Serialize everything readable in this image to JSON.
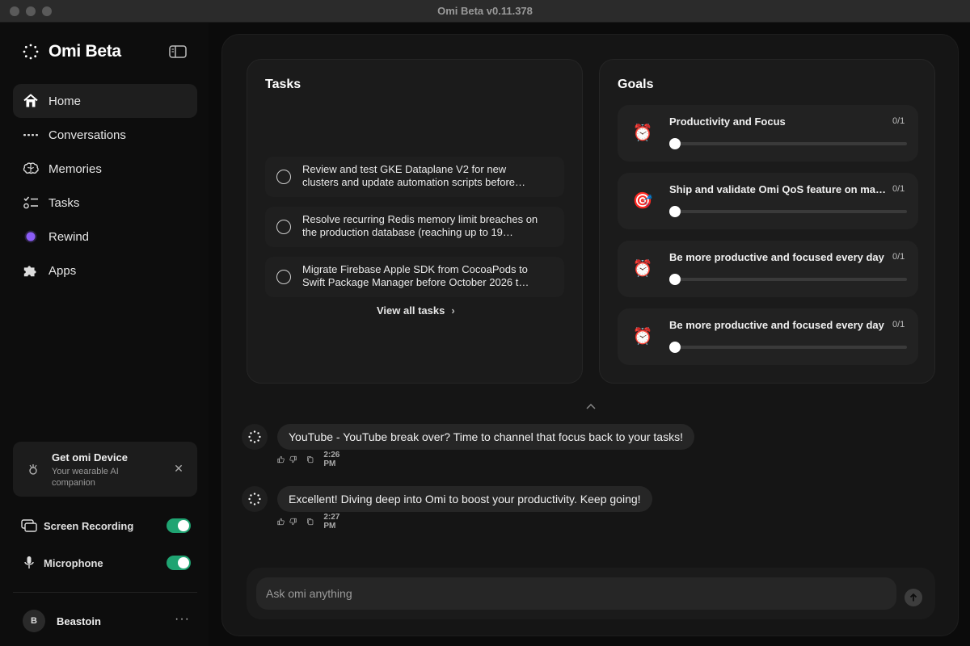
{
  "window": {
    "title": "Omi Beta v0.11.378"
  },
  "brand": {
    "name": "Omi Beta"
  },
  "nav": {
    "items": [
      {
        "label": "Home",
        "icon": "home-icon",
        "active": true
      },
      {
        "label": "Conversations",
        "icon": "dots-icon"
      },
      {
        "label": "Memories",
        "icon": "brain-icon"
      },
      {
        "label": "Tasks",
        "icon": "checklist-icon"
      },
      {
        "label": "Rewind",
        "icon": "rewind-dot-icon"
      },
      {
        "label": "Apps",
        "icon": "puzzle-icon"
      }
    ]
  },
  "promo": {
    "title": "Get omi Device",
    "subtitle": "Your wearable AI companion"
  },
  "toggles": {
    "screen_recording": {
      "label": "Screen Recording",
      "on": true
    },
    "microphone": {
      "label": "Microphone",
      "on": true
    }
  },
  "user": {
    "initial": "B",
    "name": "Beastoin",
    "more": "···"
  },
  "tasks": {
    "title": "Tasks",
    "items": [
      {
        "text": "Review and test GKE Dataplane V2 for new clusters and update automation scripts before…"
      },
      {
        "text": "Resolve recurring Redis memory limit breaches on the production database (reaching up to 19…"
      },
      {
        "text": "Migrate Firebase Apple SDK from CocoaPods to Swift Package Manager before October 2026 t…"
      }
    ],
    "view_all": "View all tasks"
  },
  "goals": {
    "title": "Goals",
    "items": [
      {
        "icon": "alarm-clock-icon",
        "emoji": "⏰",
        "title": "Productivity and Focus",
        "count": "0/1",
        "progress": 0
      },
      {
        "icon": "target-icon",
        "emoji": "🎯",
        "title": "Ship and validate Omi QoS feature on ma…",
        "count": "0/1",
        "progress": 0
      },
      {
        "icon": "alarm-clock-icon",
        "emoji": "⏰",
        "title": "Be more productive and focused every day",
        "count": "0/1",
        "progress": 0
      },
      {
        "icon": "alarm-clock-icon",
        "emoji": "⏰",
        "title": "Be more productive and focused every day",
        "count": "0/1",
        "progress": 0
      }
    ]
  },
  "messages": [
    {
      "text": "YouTube - YouTube break over? Time to channel that focus back to your tasks!",
      "time": "2:26 PM"
    },
    {
      "text": "Excellent! Diving deep into Omi to boost your productivity. Keep going!",
      "time": "2:27 PM"
    }
  ],
  "composer": {
    "placeholder": "Ask omi anything"
  },
  "colors": {
    "accent_green": "#1fa472",
    "rewind_purple": "#8b5cf6",
    "background": "#0d0d0d",
    "panel": "#151515"
  }
}
